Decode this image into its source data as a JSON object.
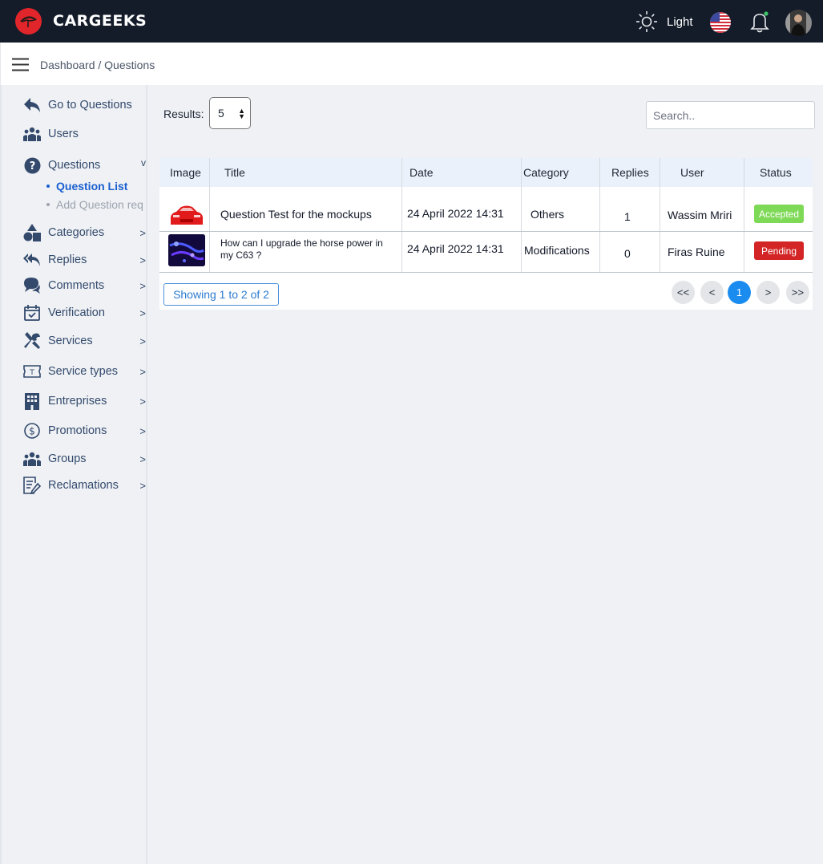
{
  "app": {
    "brand": "CARGEEKS"
  },
  "topbar": {
    "theme_label": "Light"
  },
  "breadcrumb": "Dashboard / Questions",
  "sidebar": {
    "items": [
      {
        "label": "Go to Questions",
        "icon": "reply-arrow-icon",
        "chevron": ""
      },
      {
        "label": "Users",
        "icon": "users-icon",
        "chevron": ""
      },
      {
        "label": "Questions",
        "icon": "question-circle-icon",
        "chevron": "v"
      },
      {
        "label": "Categories",
        "icon": "shapes-icon",
        "chevron": ">"
      },
      {
        "label": "Replies",
        "icon": "reply-all-icon",
        "chevron": ">"
      },
      {
        "label": "Comments",
        "icon": "comments-icon",
        "chevron": ">"
      },
      {
        "label": "Verification",
        "icon": "calendar-check-icon",
        "chevron": ">"
      },
      {
        "label": "Services",
        "icon": "tools-icon",
        "chevron": ">"
      },
      {
        "label": "Service types",
        "icon": "ticket-icon",
        "chevron": ">"
      },
      {
        "label": "Entreprises",
        "icon": "building-icon",
        "chevron": ">"
      },
      {
        "label": "Promotions",
        "icon": "dollar-circle-icon",
        "chevron": ">"
      },
      {
        "label": "Groups",
        "icon": "users-icon",
        "chevron": ">"
      },
      {
        "label": "Reclamations",
        "icon": "edit-document-icon",
        "chevron": ">"
      }
    ],
    "sub_items": [
      {
        "label": "Question List",
        "active": true
      },
      {
        "label": "Add Question req",
        "active": false
      }
    ]
  },
  "controls": {
    "results_label": "Results:",
    "results_value": "5",
    "search_placeholder": "Search.."
  },
  "table": {
    "headers": [
      "Image",
      "Title",
      "Date",
      "Category",
      "Replies",
      "User",
      "Status"
    ],
    "rows": [
      {
        "title": "Question Test for the mockups",
        "date": "24 April 2022 14:31",
        "category": "Others",
        "replies": "1",
        "user": "Wassim Mriri",
        "status": "Accepted",
        "status_color": "#7ed957"
      },
      {
        "title": "How can I upgrade the horse power in my C63 ?",
        "date": "24 April 2022 14:31",
        "category": "Modifications",
        "replies": "0",
        "user": "Firas Ruine",
        "status": "Pending",
        "status_color": "#d32525"
      }
    ],
    "showing": "Showing 1 to 2 of 2"
  },
  "pagination": {
    "first": "<<",
    "prev": "<",
    "current": "1",
    "next": ">",
    "last": ">>"
  },
  "colors": {
    "topbar": "#141c2a",
    "accent": "#1a8cf0",
    "sidebar_text": "#334a6d",
    "active_sub": "#1a5fd0"
  }
}
